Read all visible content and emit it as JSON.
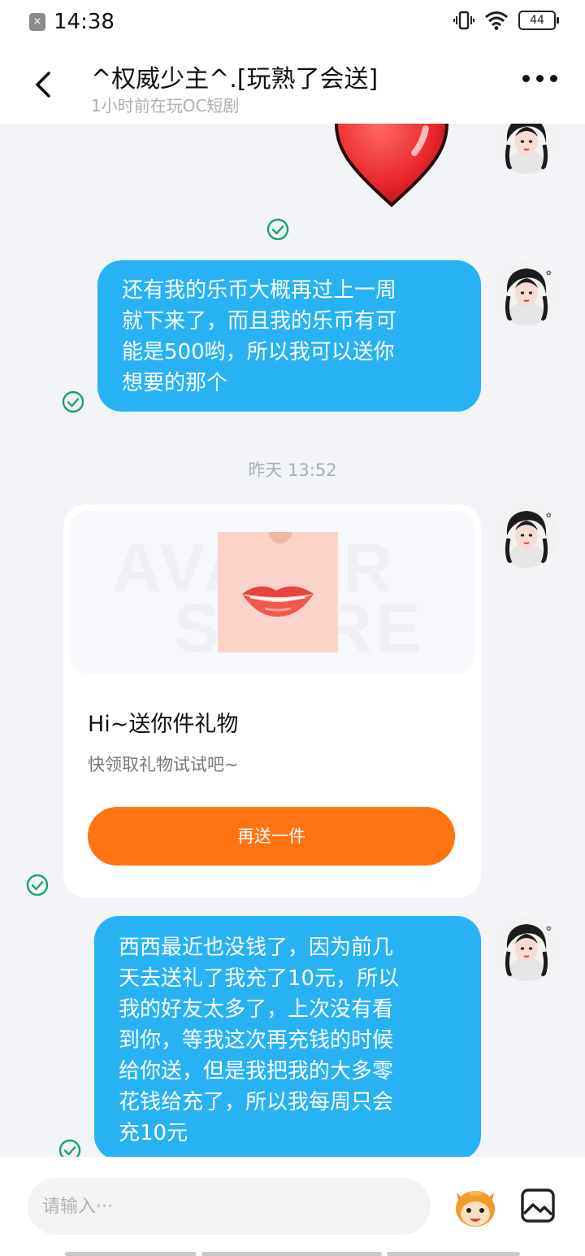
{
  "status_bar": {
    "time": "14:38",
    "battery": "44",
    "icons": [
      "notification-blocked-icon",
      "vibrate-icon",
      "wifi-icon",
      "battery-icon"
    ]
  },
  "header": {
    "title": "^权威少主^.[玩熟了会送]",
    "subtitle": "1小时前在玩OC短剧",
    "icons": [
      "back-arrow-icon",
      "more-icon"
    ]
  },
  "messages": {
    "bubble1": {
      "lines": [
        "还有我的乐币大概再过上一周",
        "就下来了，而且我的乐币有可",
        "能是500哟，所以我可以送你",
        "想要的那个"
      ]
    },
    "timestamp": "昨天 13:52",
    "gift_card": {
      "watermark_top": "AVATAR",
      "watermark_bottom": "STORE",
      "title": "Hi~送你件礼物",
      "description": "快领取礼物试试吧~",
      "button_label": "再送一件"
    },
    "bubble2": {
      "lines": [
        "西西最近也没钱了，因为前几",
        "天去送礼了我充了10元，所以",
        "我的好友太多了，上次没有看",
        "到你，等我这次再充钱的时候",
        "给你送，但是我把我的大多零",
        "花钱给充了，所以我每周只会",
        "充10元"
      ]
    }
  },
  "input_bar": {
    "placeholder": "请输入···",
    "icons": [
      "emoji-mascot-icon",
      "image-icon"
    ]
  },
  "colors": {
    "bubble": "#27b3f3",
    "chat_background": "#f2f4f8",
    "button": "#ff7311",
    "read_check": "#1aa36f"
  }
}
